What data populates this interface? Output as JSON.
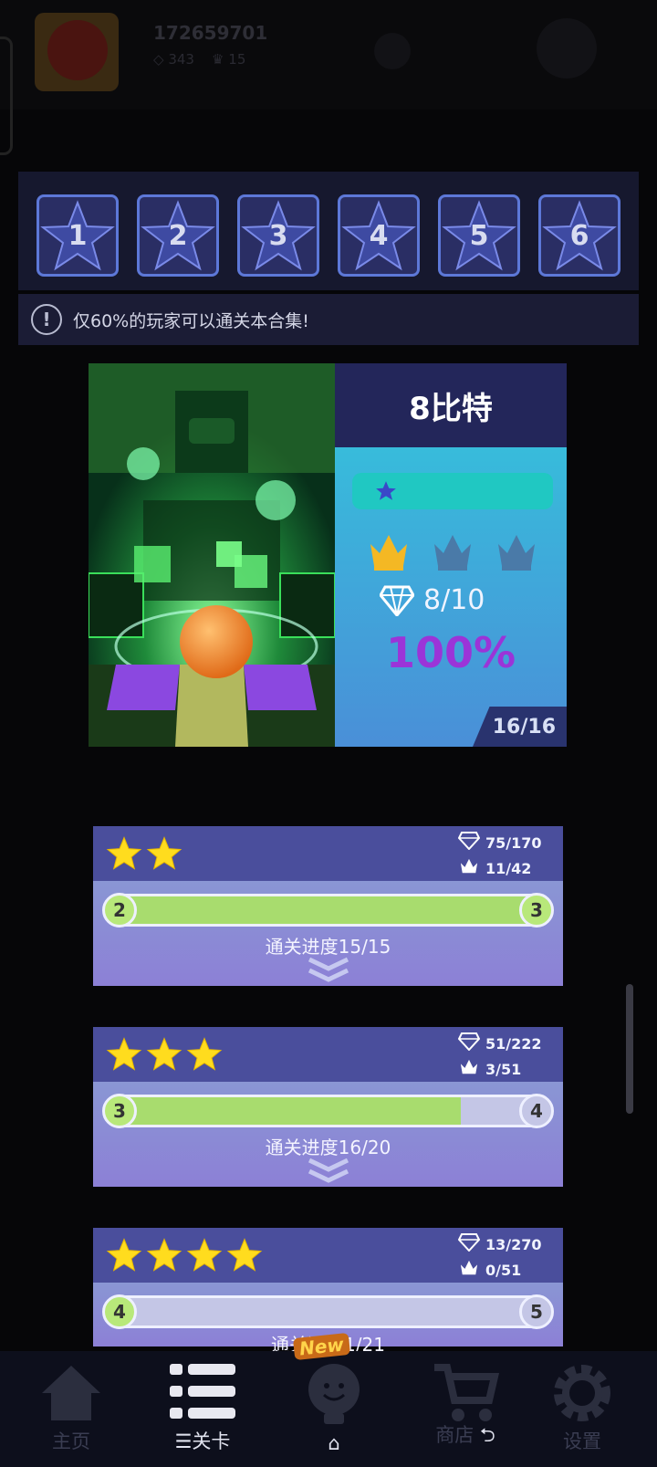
{
  "profile": {
    "user_id": "172659701",
    "gems": "343",
    "crowns": "15"
  },
  "level_tabs": [
    "1",
    "2",
    "3",
    "4",
    "5",
    "6"
  ],
  "notice": {
    "text": "仅60%的玩家可以通关本合集!"
  },
  "level_card": {
    "title": "8比特",
    "gems": "8/10",
    "percent": "100%",
    "count": "16/16",
    "stars": 1,
    "crowns_earned": 1,
    "crowns_total": 3
  },
  "progress_cards": [
    {
      "stars": 2,
      "gems": "75/170",
      "crowns": "11/42",
      "from": "2",
      "to": "3",
      "fill": 1.0,
      "progress_text": "通关进度15/15"
    },
    {
      "stars": 3,
      "gems": "51/222",
      "crowns": "3/51",
      "from": "3",
      "to": "4",
      "fill": 0.8,
      "progress_text": "通关进度16/20"
    },
    {
      "stars": 4,
      "gems": "13/270",
      "crowns": "0/51",
      "from": "4",
      "to": "5",
      "fill": 0.048,
      "progress_text": "通关进度1/21"
    }
  ],
  "nav": {
    "home": "主页",
    "levels": "关卡",
    "middle": "",
    "shop": "商店",
    "settings": "设置",
    "new_badge": "New"
  },
  "colors": {
    "accent_purple": "#9b34d8",
    "progress_green": "#a8dc6e",
    "star_yellow": "#ffdc1e"
  }
}
